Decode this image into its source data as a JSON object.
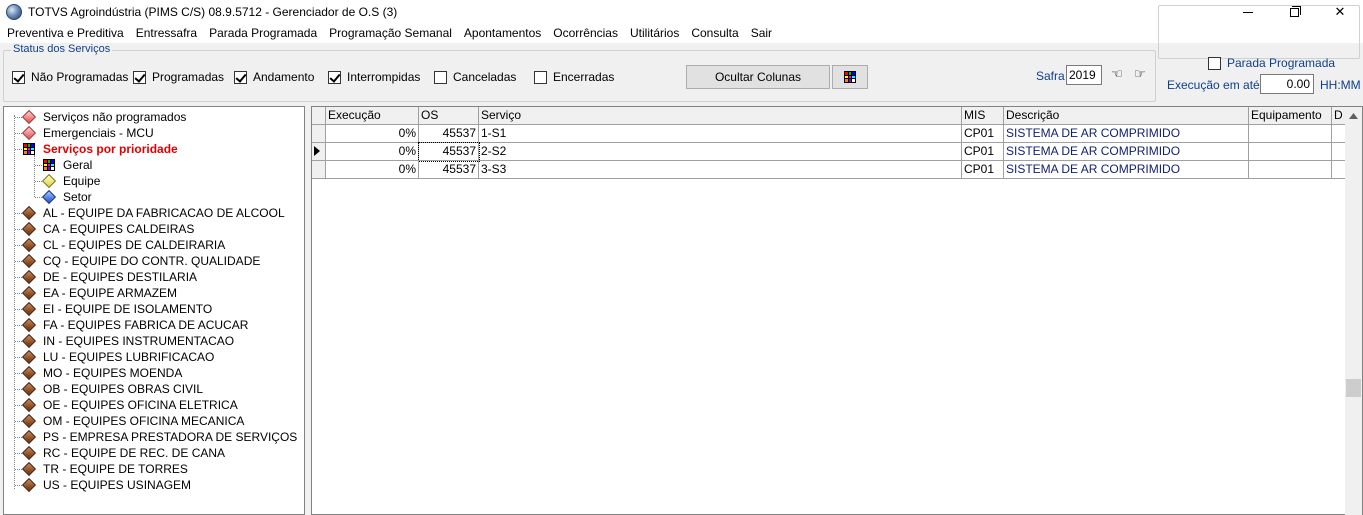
{
  "window": {
    "title": "TOTVS Agroindústria (PIMS C/S) 08.9.5712 - Gerenciador de O.S (3)",
    "minimize": "minimize",
    "maximize": "restore",
    "close": "✕"
  },
  "menu": [
    "Preventiva e Preditiva",
    "Entressafra",
    "Parada Programada",
    "Programação Semanal",
    "Apontamentos",
    "Ocorrências",
    "Utilitários",
    "Consulta",
    "Sair"
  ],
  "status_group": {
    "legend": "Status dos Serviços",
    "checkboxes": [
      {
        "label": "Não Programadas",
        "checked": true
      },
      {
        "label": "Programadas",
        "checked": true
      },
      {
        "label": "Andamento",
        "checked": true
      },
      {
        "label": "Interrompidas",
        "checked": true
      },
      {
        "label": "Canceladas",
        "checked": false
      },
      {
        "label": "Encerradas",
        "checked": false
      }
    ],
    "hide_columns_button": "Ocultar Colunas",
    "safra_label": "Safra",
    "safra_value": "2019"
  },
  "right_group": {
    "parada_label": "Parada Programada",
    "parada_checked": false,
    "exec_label": "Execução em até:",
    "exec_value": "0.00",
    "exec_unit": "HH:MM"
  },
  "tree": {
    "items": [
      {
        "label": "Serviços não programados",
        "icon": "red-diamond-icon",
        "bold": false
      },
      {
        "label": "Emergenciais - MCU",
        "icon": "red-diamond-icon",
        "bold": false
      },
      {
        "label": "Serviços por prioridade",
        "icon": "color-grid-icon",
        "bold": true
      },
      {
        "label": "Geral",
        "icon": "color-grid-icon",
        "bold": false
      },
      {
        "label": "Equipe",
        "icon": "yellow-diamond-icon",
        "bold": false
      },
      {
        "label": "Setor",
        "icon": "blue-diamond-icon",
        "bold": false
      },
      {
        "label": "AL - EQUIPE DA FABRICACAO DE ALCOOL",
        "icon": "brown-diamond-icon",
        "bold": false
      },
      {
        "label": "CA - EQUIPES CALDEIRAS",
        "icon": "brown-diamond-icon",
        "bold": false
      },
      {
        "label": "CL - EQUIPES DE CALDEIRARIA",
        "icon": "brown-diamond-icon",
        "bold": false
      },
      {
        "label": "CQ - EQUIPE DO CONTR. QUALIDADE",
        "icon": "brown-diamond-icon",
        "bold": false
      },
      {
        "label": "DE - EQUIPES DESTILARIA",
        "icon": "brown-diamond-icon",
        "bold": false
      },
      {
        "label": "EA - EQUIPE ARMAZEM",
        "icon": "brown-diamond-icon",
        "bold": false
      },
      {
        "label": "EI - EQUIPE DE ISOLAMENTO",
        "icon": "brown-diamond-icon",
        "bold": false
      },
      {
        "label": "FA - EQUIPES FABRICA DE ACUCAR",
        "icon": "brown-diamond-icon",
        "bold": false
      },
      {
        "label": "IN - EQUIPES INSTRUMENTACAO",
        "icon": "brown-diamond-icon",
        "bold": false
      },
      {
        "label": "LU - EQUIPES LUBRIFICACAO",
        "icon": "brown-diamond-icon",
        "bold": false
      },
      {
        "label": "MO - EQUIPES MOENDA",
        "icon": "brown-diamond-icon",
        "bold": false
      },
      {
        "label": "OB - EQUIPES OBRAS CIVIL",
        "icon": "brown-diamond-icon",
        "bold": false
      },
      {
        "label": "OE - EQUIPES OFICINA ELETRICA",
        "icon": "brown-diamond-icon",
        "bold": false
      },
      {
        "label": "OM - EQUIPES OFICINA MECANICA",
        "icon": "brown-diamond-icon",
        "bold": false
      },
      {
        "label": "PS - EMPRESA PRESTADORA DE SERVIÇOS",
        "icon": "brown-diamond-icon",
        "bold": false
      },
      {
        "label": "RC - EQUIPE DE REC. DE CANA",
        "icon": "brown-diamond-icon",
        "bold": false
      },
      {
        "label": "TR - EQUIPE DE TORRES",
        "icon": "brown-diamond-icon",
        "bold": false
      },
      {
        "label": "US - EQUIPES USINAGEM",
        "icon": "brown-diamond-icon",
        "bold": false
      }
    ]
  },
  "grid": {
    "columns": [
      "Execução",
      "OS",
      "Serviço",
      "MIS",
      "Descrição",
      "Equipamento",
      "D"
    ],
    "rows": [
      {
        "execucao": "0%",
        "os": "45537",
        "servico": "1-S1",
        "mis": "CP01",
        "descricao": "SISTEMA DE AR COMPRIMIDO",
        "equipamento": "",
        "d": ""
      },
      {
        "execucao": "0%",
        "os": "45537",
        "servico": "2-S2",
        "mis": "CP01",
        "descricao": "SISTEMA DE AR COMPRIMIDO",
        "equipamento": "",
        "d": ""
      },
      {
        "execucao": "0%",
        "os": "45537",
        "servico": "3-S3",
        "mis": "CP01",
        "descricao": "SISTEMA DE AR COMPRIMIDO",
        "equipamento": "",
        "d": ""
      }
    ],
    "current_row": 1
  },
  "colors": {
    "label_blue": "#0f3f8c",
    "priority_red": "#e00000",
    "desc_navy": "#0f1f6e"
  }
}
